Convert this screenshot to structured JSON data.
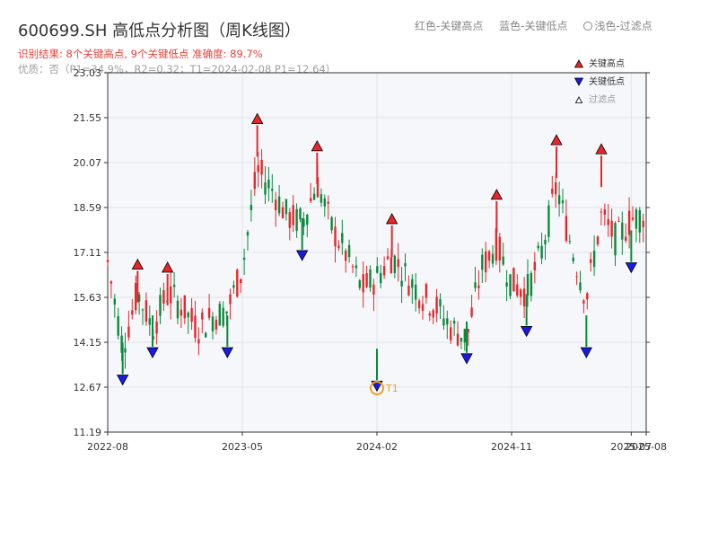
{
  "header": {
    "title": "600699.SH 高低点分析图（周K线图）",
    "subtitle": "识别结果: 8个关键高点, 9个关键低点  准确度: 89.7%",
    "quality_line": "优质：否（P1=34.9%，R2=0.32；T1=2024-02-08 P1=12.64）"
  },
  "top_legend": {
    "high": "红色-关键高点",
    "low": "蓝色-关键低点",
    "filtered": "浅色-过滤点"
  },
  "colors": {
    "up": "#e8262a",
    "down": "#0a8a3c",
    "high_marker": "#e8262a",
    "low_marker": "#1a1ae6",
    "highlight": "#f0a020",
    "plot_bg": "#f5f7fa",
    "grid": "#e0e3e8"
  },
  "chart_data": {
    "type": "candlestick",
    "title": "600699.SH 高低点分析图（周K线图）",
    "xlim": [
      "2022-08",
      "2025-08"
    ],
    "x_ticks": [
      "2022-08",
      "2023-05",
      "2024-02",
      "2024-11",
      "2025-07",
      "2025-08"
    ],
    "ylim": [
      11.19,
      23.03
    ],
    "y_ticks": [
      "11.19",
      "12.67",
      "14.15",
      "15.63",
      "17.11",
      "18.59",
      "20.07",
      "21.55",
      "23.03"
    ],
    "grid": true,
    "legend": {
      "placement": "top-right",
      "entries": [
        "关键高点",
        "关键低点",
        "过滤点"
      ]
    },
    "key_highs": [
      {
        "date": "2022-10",
        "price": 16.5
      },
      {
        "date": "2022-12",
        "price": 16.4
      },
      {
        "date": "2023-06",
        "price": 21.3
      },
      {
        "date": "2023-10",
        "price": 20.4
      },
      {
        "date": "2024-03",
        "price": 18.0
      },
      {
        "date": "2024-10",
        "price": 18.8
      },
      {
        "date": "2025-02",
        "price": 20.6
      },
      {
        "date": "2025-05",
        "price": 20.3
      }
    ],
    "key_lows": [
      {
        "date": "2022-09",
        "price": 13.1
      },
      {
        "date": "2022-11",
        "price": 14.0
      },
      {
        "date": "2023-04",
        "price": 14.0
      },
      {
        "date": "2023-09",
        "price": 17.2
      },
      {
        "date": "2024-02",
        "price": 12.9
      },
      {
        "date": "2024-08",
        "price": 13.8
      },
      {
        "date": "2024-12",
        "price": 14.7
      },
      {
        "date": "2025-04",
        "price": 14.0
      },
      {
        "date": "2025-07",
        "price": 16.8
      }
    ],
    "highlight": {
      "label": "T1",
      "date": "2024-02",
      "price": 12.64
    },
    "candles": []
  }
}
